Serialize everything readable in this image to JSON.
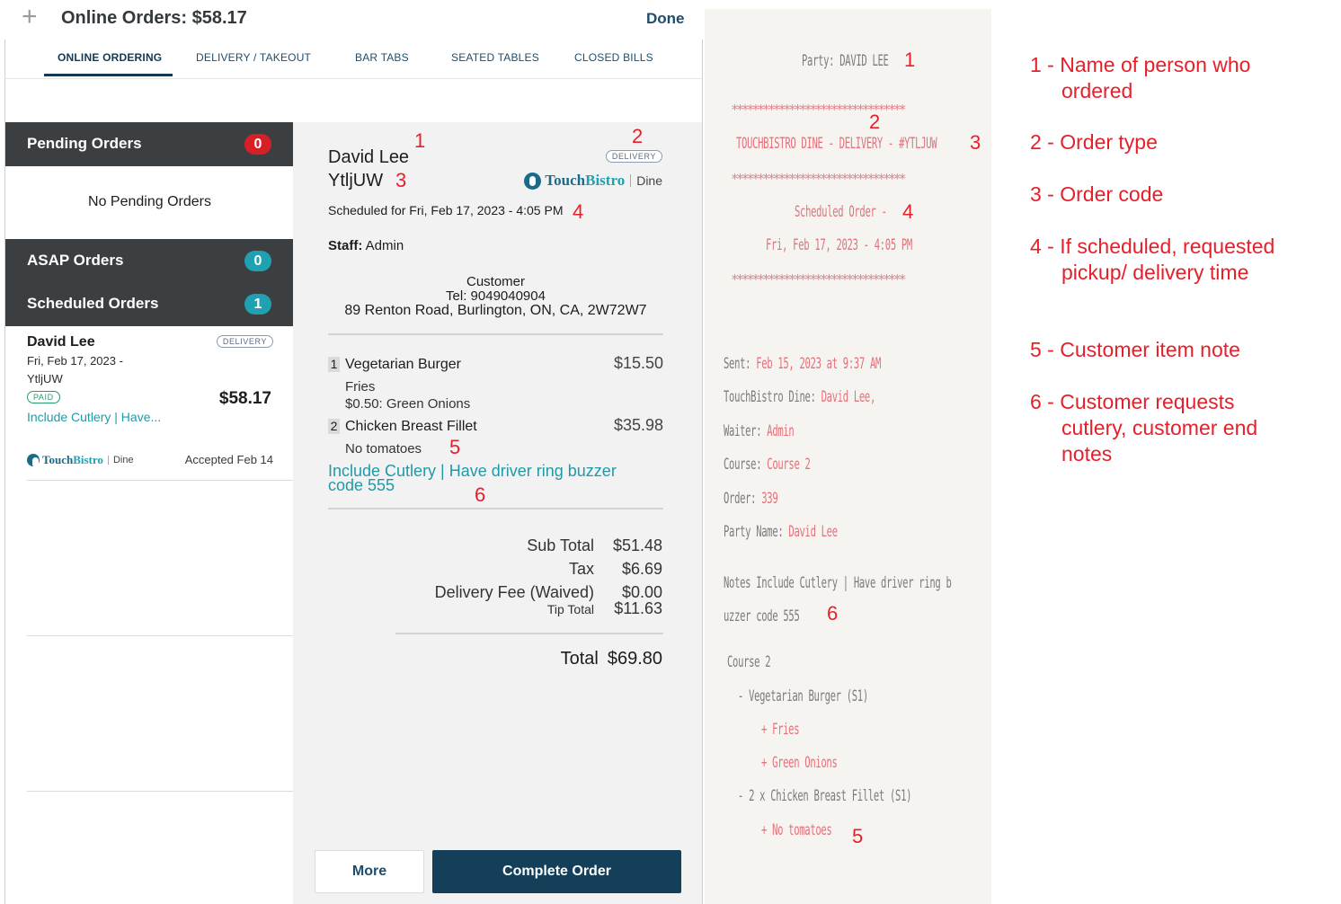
{
  "app": {
    "title": "Online Orders: $58.17",
    "done_label": "Done",
    "tabs": [
      {
        "label": "ONLINE ORDERING",
        "active": true
      },
      {
        "label": "DELIVERY / TAKEOUT",
        "active": false
      },
      {
        "label": "BAR TABS",
        "active": false
      },
      {
        "label": "SEATED TABLES",
        "active": false
      },
      {
        "label": "CLOSED BILLS",
        "active": false
      }
    ],
    "sections": {
      "pending": {
        "label": "Pending Orders",
        "count": "0",
        "empty_text": "No Pending Orders"
      },
      "asap": {
        "label": "ASAP Orders",
        "count": "0"
      },
      "scheduled": {
        "label": "Scheduled Orders",
        "count": "1"
      }
    },
    "order_card": {
      "name": "David Lee",
      "type": "DELIVERY",
      "date": "Fri, Feb 17, 2023 -",
      "code": "YtljUW",
      "paid": "PAID",
      "total": "$58.17",
      "note": "Include Cutlery | Have...",
      "brand_a": "Touch",
      "brand_b": "Bistro",
      "brand_dine": "Dine",
      "accepted": "Accepted Feb 14"
    },
    "detail": {
      "name": "David Lee",
      "code": "YtljUW",
      "type": "DELIVERY",
      "brand_a": "Touch",
      "brand_b": "Bistro",
      "brand_dine": "Dine",
      "scheduled": "Scheduled for Fri, Feb 17, 2023 - 4:05 PM",
      "staff_label": "Staff:",
      "staff_value": " Admin",
      "customer_label": "Customer",
      "customer_tel": "Tel: 9049040904",
      "customer_address": "89 Renton Road, Burlington, ON, CA, 2W72W7",
      "items": [
        {
          "qty": "1",
          "name": "Vegetarian Burger",
          "price": "$15.50",
          "mods": [
            "Fries",
            "$0.50: Green Onions"
          ]
        },
        {
          "qty": "2",
          "name": "Chicken Breast Fillet",
          "price": "$35.98",
          "mods": [
            "No tomatoes"
          ]
        }
      ],
      "order_note": "Include Cutlery | Have driver ring buzzer code 555",
      "totals": {
        "subtotal_label": "Sub Total",
        "subtotal": "$51.48",
        "tax_label": "Tax",
        "tax": "$6.69",
        "delivery_label": "Delivery Fee (Waived)",
        "delivery": "$0.00",
        "tip_label": "Tip Total",
        "tip": "$11.63",
        "total_label": "Total",
        "total": "$69.80"
      },
      "more_label": "More",
      "complete_label": "Complete Order"
    },
    "callouts": [
      "1",
      "2",
      "3",
      "4",
      "5",
      "6"
    ]
  },
  "receipt": {
    "party": "Party: DAVID LEE",
    "stars": "*********************************",
    "header": "TOUCHBISTRO DINE - DELIVERY - #YTLJUW",
    "scheduled": "Scheduled Order -",
    "datetime": "Fri, Feb 17, 2023 - 4:05 PM",
    "sent_label": "Sent:",
    "sent_value": " Feb 15, 2023 at 9:37 AM",
    "dine_label": "TouchBistro Dine:",
    "dine_value": " David Lee,",
    "waiter_label": "Waiter:",
    "waiter_value": " Admin",
    "course_label": "Course:",
    "course_value": " Course 2",
    "order_label": "Order:",
    "order_value": " 339",
    "partyname_label": "Party Name:",
    "partyname_value": " David Lee",
    "notes_line1": "Notes Include Cutlery | Have driver ring b",
    "notes_line2": "uzzer code 555",
    "course_head": "Course 2",
    "line_burger": "- Vegetarian Burger (S1)",
    "line_fries": "+ Fries",
    "line_onions": "+ Green Onions",
    "line_chicken": "- 2 x Chicken Breast Fillet (S1)",
    "line_tomatoes": "+ No tomatoes"
  },
  "legend": [
    "1 - Name of person who ordered",
    "2 - Order type",
    "3 - Order code",
    "4 - If scheduled, requested pickup/ delivery time",
    "5 - Customer item note",
    "6 - Customer requests cutlery, customer end notes"
  ],
  "colors": {
    "annotation_red": "#e5202b",
    "navy": "#133f58",
    "teal": "#1fa1b1",
    "badge_red": "#d91f26"
  }
}
